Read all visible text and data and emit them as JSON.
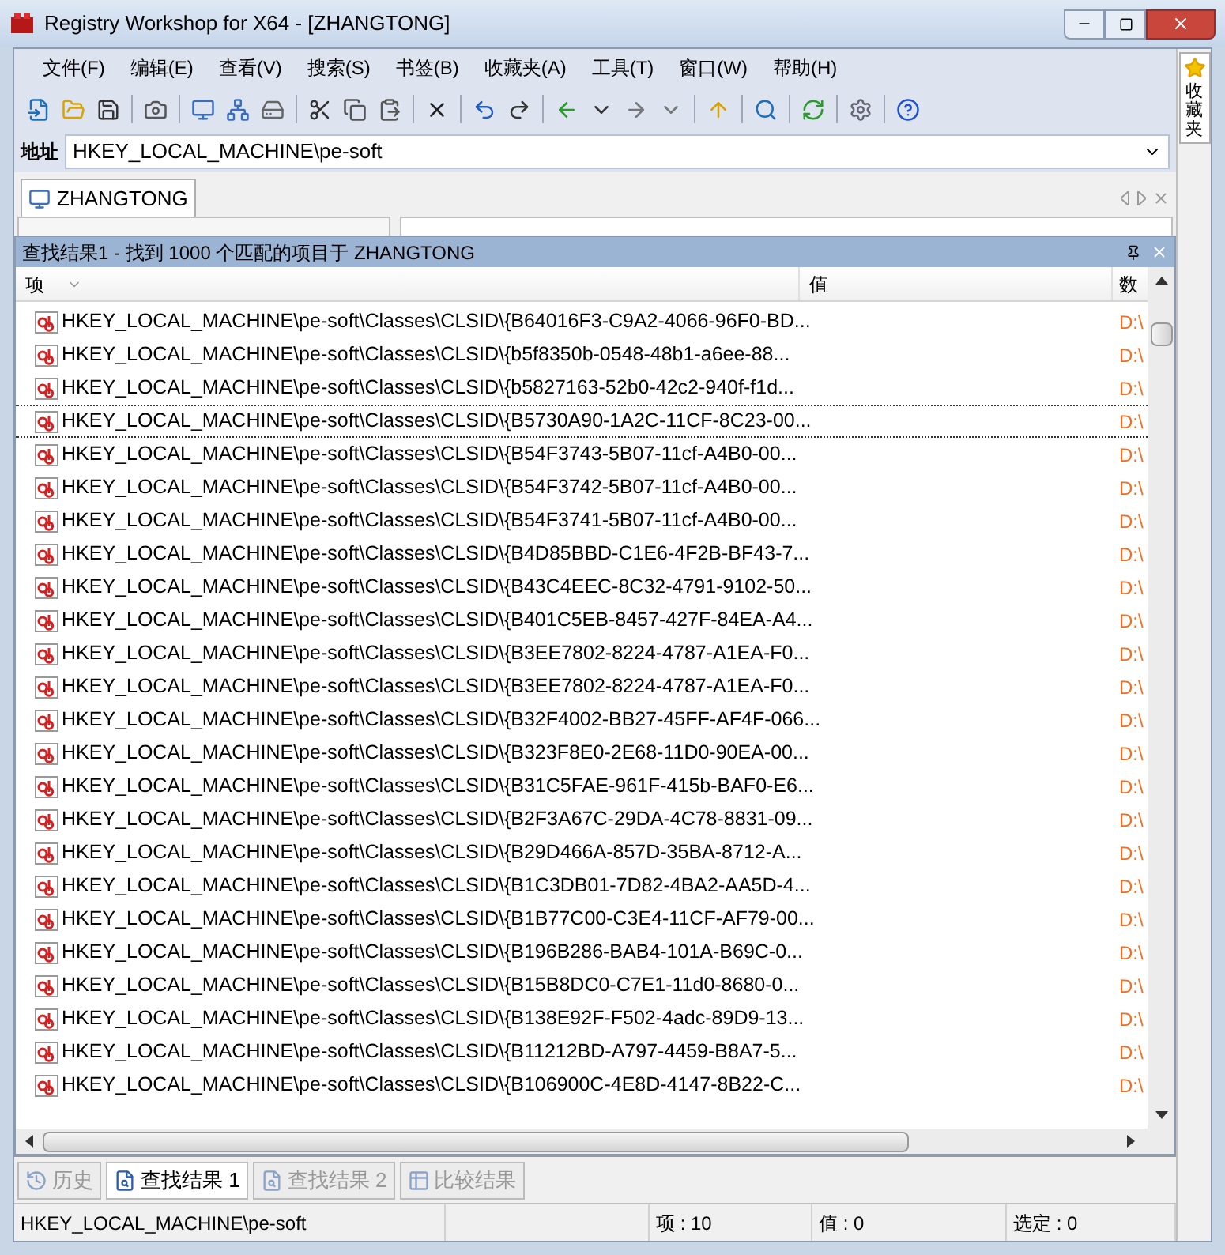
{
  "window": {
    "title": "Registry Workshop for X64 - [ZHANGTONG]"
  },
  "menu": [
    "文件(F)",
    "编辑(E)",
    "查看(V)",
    "搜索(S)",
    "书签(B)",
    "收藏夹(A)",
    "工具(T)",
    "窗口(W)",
    "帮助(H)"
  ],
  "address": {
    "label": "地址",
    "value": "HKEY_LOCAL_MACHINE\\pe-soft"
  },
  "document_tab": {
    "label": "ZHANGTONG"
  },
  "favorites_tab": {
    "label": "收藏夹"
  },
  "results_panel": {
    "title": "查找结果1 - 找到 1000 个匹配的项目于 ZHANGTONG",
    "columns": [
      "项",
      "值",
      "数"
    ],
    "rows": [
      {
        "item": "HKEY_LOCAL_MACHINE\\pe-soft\\Classes\\CLSID\\{B64016F3-C9A2-4066-96F0-BD...",
        "data": "D:\\",
        "selected": false
      },
      {
        "item": "HKEY_LOCAL_MACHINE\\pe-soft\\Classes\\CLSID\\{b5f8350b-0548-48b1-a6ee-88...",
        "data": "D:\\",
        "selected": false
      },
      {
        "item": "HKEY_LOCAL_MACHINE\\pe-soft\\Classes\\CLSID\\{b5827163-52b0-42c2-940f-f1d...",
        "data": "D:\\",
        "selected": false
      },
      {
        "item": "HKEY_LOCAL_MACHINE\\pe-soft\\Classes\\CLSID\\{B5730A90-1A2C-11CF-8C23-00...",
        "data": "D:\\",
        "selected": true
      },
      {
        "item": "HKEY_LOCAL_MACHINE\\pe-soft\\Classes\\CLSID\\{B54F3743-5B07-11cf-A4B0-00...",
        "data": "D:\\",
        "selected": false
      },
      {
        "item": "HKEY_LOCAL_MACHINE\\pe-soft\\Classes\\CLSID\\{B54F3742-5B07-11cf-A4B0-00...",
        "data": "D:\\",
        "selected": false
      },
      {
        "item": "HKEY_LOCAL_MACHINE\\pe-soft\\Classes\\CLSID\\{B54F3741-5B07-11cf-A4B0-00...",
        "data": "D:\\",
        "selected": false
      },
      {
        "item": "HKEY_LOCAL_MACHINE\\pe-soft\\Classes\\CLSID\\{B4D85BBD-C1E6-4F2B-BF43-7...",
        "data": "D:\\",
        "selected": false
      },
      {
        "item": "HKEY_LOCAL_MACHINE\\pe-soft\\Classes\\CLSID\\{B43C4EEC-8C32-4791-9102-50...",
        "data": "D:\\",
        "selected": false
      },
      {
        "item": "HKEY_LOCAL_MACHINE\\pe-soft\\Classes\\CLSID\\{B401C5EB-8457-427F-84EA-A4...",
        "data": "D:\\",
        "selected": false
      },
      {
        "item": "HKEY_LOCAL_MACHINE\\pe-soft\\Classes\\CLSID\\{B3EE7802-8224-4787-A1EA-F0...",
        "data": "D:\\",
        "selected": false
      },
      {
        "item": "HKEY_LOCAL_MACHINE\\pe-soft\\Classes\\CLSID\\{B3EE7802-8224-4787-A1EA-F0...",
        "data": "D:\\",
        "selected": false
      },
      {
        "item": "HKEY_LOCAL_MACHINE\\pe-soft\\Classes\\CLSID\\{B32F4002-BB27-45FF-AF4F-066...",
        "data": "D:\\",
        "selected": false
      },
      {
        "item": "HKEY_LOCAL_MACHINE\\pe-soft\\Classes\\CLSID\\{B323F8E0-2E68-11D0-90EA-00...",
        "data": "D:\\",
        "selected": false
      },
      {
        "item": "HKEY_LOCAL_MACHINE\\pe-soft\\Classes\\CLSID\\{B31C5FAE-961F-415b-BAF0-E6...",
        "data": "D:\\",
        "selected": false
      },
      {
        "item": "HKEY_LOCAL_MACHINE\\pe-soft\\Classes\\CLSID\\{B2F3A67C-29DA-4C78-8831-09...",
        "data": "D:\\",
        "selected": false
      },
      {
        "item": "HKEY_LOCAL_MACHINE\\pe-soft\\Classes\\CLSID\\{B29D466A-857D-35BA-8712-A...",
        "data": "D:\\",
        "selected": false
      },
      {
        "item": "HKEY_LOCAL_MACHINE\\pe-soft\\Classes\\CLSID\\{B1C3DB01-7D82-4BA2-AA5D-4...",
        "data": "D:\\",
        "selected": false
      },
      {
        "item": "HKEY_LOCAL_MACHINE\\pe-soft\\Classes\\CLSID\\{B1B77C00-C3E4-11CF-AF79-00...",
        "data": "D:\\",
        "selected": false
      },
      {
        "item": "HKEY_LOCAL_MACHINE\\pe-soft\\Classes\\CLSID\\{B196B286-BAB4-101A-B69C-0...",
        "data": "D:\\",
        "selected": false
      },
      {
        "item": "HKEY_LOCAL_MACHINE\\pe-soft\\Classes\\CLSID\\{B15B8DC0-C7E1-11d0-8680-0...",
        "data": "D:\\",
        "selected": false
      },
      {
        "item": "HKEY_LOCAL_MACHINE\\pe-soft\\Classes\\CLSID\\{B138E92F-F502-4adc-89D9-13...",
        "data": "D:\\",
        "selected": false
      },
      {
        "item": "HKEY_LOCAL_MACHINE\\pe-soft\\Classes\\CLSID\\{B11212BD-A797-4459-B8A7-5...",
        "data": "D:\\",
        "selected": false
      },
      {
        "item": "HKEY_LOCAL_MACHINE\\pe-soft\\Classes\\CLSID\\{B106900C-4E8D-4147-8B22-C...",
        "data": "D:\\",
        "selected": false
      }
    ]
  },
  "bottom_tabs": [
    {
      "label": "历史",
      "selected": false,
      "disabled": true
    },
    {
      "label": "查找结果 1",
      "selected": true,
      "disabled": false
    },
    {
      "label": "查找结果 2",
      "selected": false,
      "disabled": true
    },
    {
      "label": "比较结果",
      "selected": false,
      "disabled": true
    }
  ],
  "status_bar": [
    "HKEY_LOCAL_MACHINE\\pe-soft",
    "项 : 10",
    "值 : 0",
    "选定 : 0"
  ]
}
